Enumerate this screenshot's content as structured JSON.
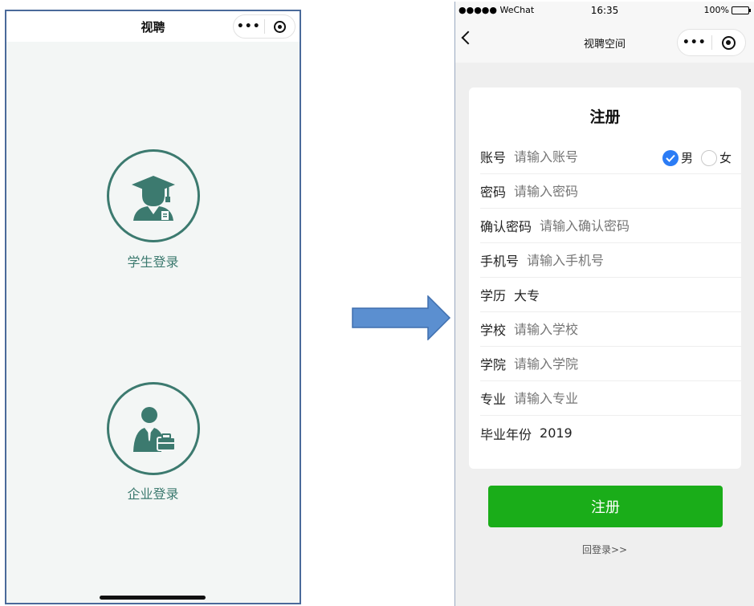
{
  "left_screen": {
    "title": "视聘",
    "capsule_more": "•••",
    "student_login": "学生登录",
    "company_login": "企业登录"
  },
  "right_screen": {
    "status": {
      "carrier": "●●●●● WeChat",
      "time": "16:35",
      "battery": "100%"
    },
    "title": "视聘空间",
    "capsule_more": "•••",
    "form_title": "注册",
    "fields": {
      "account": {
        "label": "账号",
        "placeholder": "请输入账号"
      },
      "password": {
        "label": "密码",
        "placeholder": "请输入密码"
      },
      "confirm_password": {
        "label": "确认密码",
        "placeholder": "请输入确认密码"
      },
      "phone": {
        "label": "手机号",
        "placeholder": "请输入手机号"
      },
      "education": {
        "label": "学历",
        "value": "大专"
      },
      "school": {
        "label": "学校",
        "placeholder": "请输入学校"
      },
      "college": {
        "label": "学院",
        "placeholder": "请输入学院"
      },
      "major": {
        "label": "专业",
        "placeholder": "请输入专业"
      },
      "grad_year": {
        "label": "毕业年份",
        "value": "2019"
      }
    },
    "gender": {
      "male": "男",
      "female": "女",
      "selected": "男"
    },
    "register_button": "注册",
    "back_to_login": "回登录>>"
  },
  "colors": {
    "brand_teal": "#3c7a6f",
    "wechat_green": "#1aad19",
    "radio_blue": "#2b7cf5",
    "arrow_blue": "#5b8fd0"
  }
}
